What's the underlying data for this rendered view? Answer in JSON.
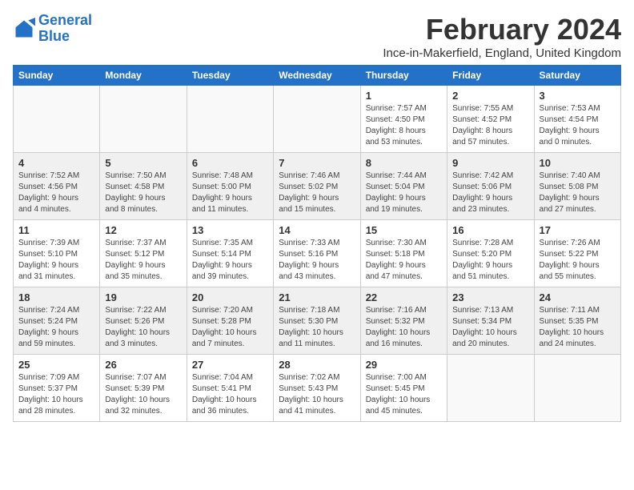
{
  "app": {
    "name": "GeneralBlue",
    "logo_text_1": "General",
    "logo_text_2": "Blue"
  },
  "header": {
    "month_year": "February 2024",
    "location": "Ince-in-Makerfield, England, United Kingdom"
  },
  "weekdays": [
    "Sunday",
    "Monday",
    "Tuesday",
    "Wednesday",
    "Thursday",
    "Friday",
    "Saturday"
  ],
  "weeks": [
    [
      {
        "day": "",
        "info": ""
      },
      {
        "day": "",
        "info": ""
      },
      {
        "day": "",
        "info": ""
      },
      {
        "day": "",
        "info": ""
      },
      {
        "day": "1",
        "info": "Sunrise: 7:57 AM\nSunset: 4:50 PM\nDaylight: 8 hours\nand 53 minutes."
      },
      {
        "day": "2",
        "info": "Sunrise: 7:55 AM\nSunset: 4:52 PM\nDaylight: 8 hours\nand 57 minutes."
      },
      {
        "day": "3",
        "info": "Sunrise: 7:53 AM\nSunset: 4:54 PM\nDaylight: 9 hours\nand 0 minutes."
      }
    ],
    [
      {
        "day": "4",
        "info": "Sunrise: 7:52 AM\nSunset: 4:56 PM\nDaylight: 9 hours\nand 4 minutes."
      },
      {
        "day": "5",
        "info": "Sunrise: 7:50 AM\nSunset: 4:58 PM\nDaylight: 9 hours\nand 8 minutes."
      },
      {
        "day": "6",
        "info": "Sunrise: 7:48 AM\nSunset: 5:00 PM\nDaylight: 9 hours\nand 11 minutes."
      },
      {
        "day": "7",
        "info": "Sunrise: 7:46 AM\nSunset: 5:02 PM\nDaylight: 9 hours\nand 15 minutes."
      },
      {
        "day": "8",
        "info": "Sunrise: 7:44 AM\nSunset: 5:04 PM\nDaylight: 9 hours\nand 19 minutes."
      },
      {
        "day": "9",
        "info": "Sunrise: 7:42 AM\nSunset: 5:06 PM\nDaylight: 9 hours\nand 23 minutes."
      },
      {
        "day": "10",
        "info": "Sunrise: 7:40 AM\nSunset: 5:08 PM\nDaylight: 9 hours\nand 27 minutes."
      }
    ],
    [
      {
        "day": "11",
        "info": "Sunrise: 7:39 AM\nSunset: 5:10 PM\nDaylight: 9 hours\nand 31 minutes."
      },
      {
        "day": "12",
        "info": "Sunrise: 7:37 AM\nSunset: 5:12 PM\nDaylight: 9 hours\nand 35 minutes."
      },
      {
        "day": "13",
        "info": "Sunrise: 7:35 AM\nSunset: 5:14 PM\nDaylight: 9 hours\nand 39 minutes."
      },
      {
        "day": "14",
        "info": "Sunrise: 7:33 AM\nSunset: 5:16 PM\nDaylight: 9 hours\nand 43 minutes."
      },
      {
        "day": "15",
        "info": "Sunrise: 7:30 AM\nSunset: 5:18 PM\nDaylight: 9 hours\nand 47 minutes."
      },
      {
        "day": "16",
        "info": "Sunrise: 7:28 AM\nSunset: 5:20 PM\nDaylight: 9 hours\nand 51 minutes."
      },
      {
        "day": "17",
        "info": "Sunrise: 7:26 AM\nSunset: 5:22 PM\nDaylight: 9 hours\nand 55 minutes."
      }
    ],
    [
      {
        "day": "18",
        "info": "Sunrise: 7:24 AM\nSunset: 5:24 PM\nDaylight: 9 hours\nand 59 minutes."
      },
      {
        "day": "19",
        "info": "Sunrise: 7:22 AM\nSunset: 5:26 PM\nDaylight: 10 hours\nand 3 minutes."
      },
      {
        "day": "20",
        "info": "Sunrise: 7:20 AM\nSunset: 5:28 PM\nDaylight: 10 hours\nand 7 minutes."
      },
      {
        "day": "21",
        "info": "Sunrise: 7:18 AM\nSunset: 5:30 PM\nDaylight: 10 hours\nand 11 minutes."
      },
      {
        "day": "22",
        "info": "Sunrise: 7:16 AM\nSunset: 5:32 PM\nDaylight: 10 hours\nand 16 minutes."
      },
      {
        "day": "23",
        "info": "Sunrise: 7:13 AM\nSunset: 5:34 PM\nDaylight: 10 hours\nand 20 minutes."
      },
      {
        "day": "24",
        "info": "Sunrise: 7:11 AM\nSunset: 5:35 PM\nDaylight: 10 hours\nand 24 minutes."
      }
    ],
    [
      {
        "day": "25",
        "info": "Sunrise: 7:09 AM\nSunset: 5:37 PM\nDaylight: 10 hours\nand 28 minutes."
      },
      {
        "day": "26",
        "info": "Sunrise: 7:07 AM\nSunset: 5:39 PM\nDaylight: 10 hours\nand 32 minutes."
      },
      {
        "day": "27",
        "info": "Sunrise: 7:04 AM\nSunset: 5:41 PM\nDaylight: 10 hours\nand 36 minutes."
      },
      {
        "day": "28",
        "info": "Sunrise: 7:02 AM\nSunset: 5:43 PM\nDaylight: 10 hours\nand 41 minutes."
      },
      {
        "day": "29",
        "info": "Sunrise: 7:00 AM\nSunset: 5:45 PM\nDaylight: 10 hours\nand 45 minutes."
      },
      {
        "day": "",
        "info": ""
      },
      {
        "day": "",
        "info": ""
      }
    ]
  ]
}
